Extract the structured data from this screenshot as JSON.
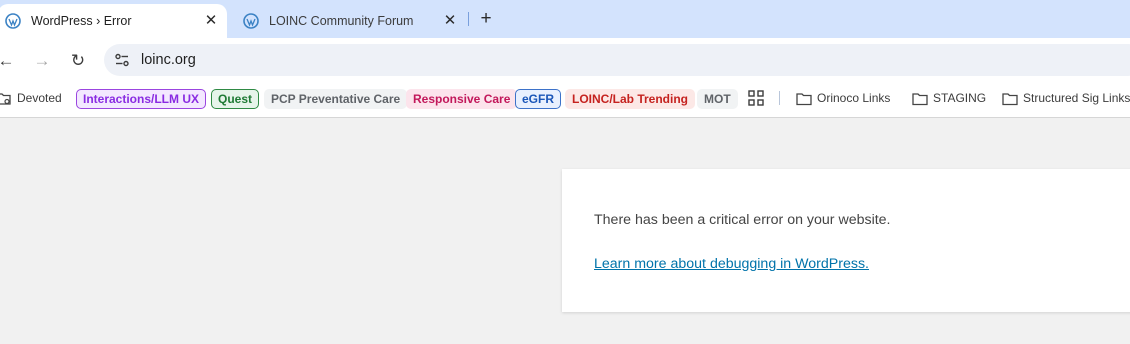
{
  "tabs": [
    {
      "title": "WordPress › Error",
      "close": "✕",
      "active": true
    },
    {
      "title": "LOINC Community Forum",
      "close": "✕",
      "active": false
    }
  ],
  "new_tab": "+",
  "toolbar": {
    "back": "←",
    "forward": "→",
    "reload": "↻",
    "url": "loinc.org"
  },
  "bookmarks": [
    {
      "label": "Devoted",
      "type": "plain",
      "icon": "folder-gear-icon"
    },
    {
      "label": "Interactions/LLM UX",
      "type": "chip",
      "color": "#8a2be2",
      "bg": "#f3e8ff",
      "border": "#9b45e0"
    },
    {
      "label": "Quest",
      "type": "chip",
      "color": "#1e7a34",
      "bg": "#e6f4ea",
      "border": "#2f8a44"
    },
    {
      "label": "PCP Preventative Care",
      "type": "chip",
      "color": "#5f6368",
      "bg": "#f1f3f4",
      "border": "transparent"
    },
    {
      "label": "Responsive Care",
      "type": "chip",
      "color": "#c2185b",
      "bg": "#fce4ec",
      "border": "transparent"
    },
    {
      "label": "eGFR",
      "type": "chip",
      "color": "#1a56b8",
      "bg": "#e8f0fe",
      "border": "#3d72c9"
    },
    {
      "label": "LOINC/Lab Trending",
      "type": "chip",
      "color": "#c5221f",
      "bg": "#fce8e6",
      "border": "transparent"
    },
    {
      "label": "MOT",
      "type": "chip",
      "color": "#5f6368",
      "bg": "#f1f3f4",
      "border": "transparent"
    },
    {
      "label": "",
      "type": "apps",
      "icon": "apps-grid-icon"
    },
    {
      "label": "Orinoco Links",
      "type": "folder",
      "icon": "folder-icon"
    },
    {
      "label": "STAGING",
      "type": "folder",
      "icon": "folder-icon"
    },
    {
      "label": "Structured Sig Links",
      "type": "folder",
      "icon": "folder-icon"
    }
  ],
  "error": {
    "message": "There has been a critical error on your website.",
    "link": "Learn more about debugging in WordPress."
  }
}
